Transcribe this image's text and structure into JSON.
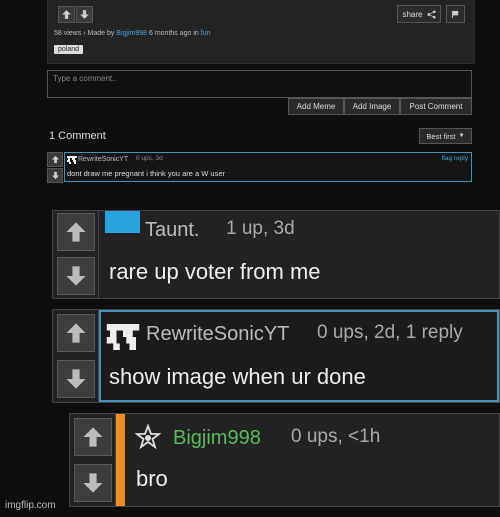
{
  "post": {
    "share_label": "share",
    "views_text": "58 views",
    "sep": "›",
    "made_by_prefix": "Made by",
    "author": "Bigjim998",
    "time_text": "6 months ago in",
    "stream": "fun",
    "tag": "poland"
  },
  "comment_form": {
    "placeholder": "Type a comment..",
    "add_meme": "Add Meme",
    "add_image": "Add Image",
    "post_comment": "Post Comment"
  },
  "comments_header": {
    "count_label": "1 Comment",
    "sort_label": "Best first"
  },
  "small_comment": {
    "user": "RewriteSonicYT",
    "meta": "0 ups, 3d",
    "flag": "flag",
    "reply": "reply",
    "text": "dont draw me pregnant i think you are a W user"
  },
  "big_comments": [
    {
      "user": "Taunt.",
      "meta": "1 up, 3d",
      "text": "rare up voter from me",
      "accent": "#29a3df"
    },
    {
      "user": "RewriteSonicYT",
      "meta": "0 ups, 2d, 1 reply",
      "text": "show image when ur done",
      "accent": "#4a8fb8"
    },
    {
      "user": "Bigjim998",
      "meta": "0 ups, <1h",
      "text": "bro",
      "accent": "#f08c1e",
      "user_color": "#5cb85c"
    }
  ],
  "watermark": "imgflip.com",
  "colors": {
    "link": "#4aa3df",
    "op_accent": "#f08c1e",
    "highlight_border": "#4a8fb8"
  }
}
